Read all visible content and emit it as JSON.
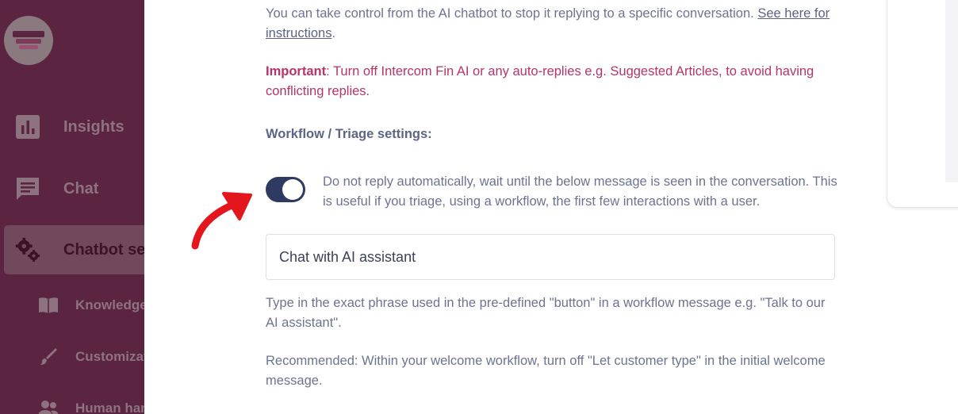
{
  "sidebar": {
    "items": [
      {
        "label": "Insights",
        "icon": "bar-chart-icon"
      },
      {
        "label": "Chat",
        "icon": "chat-icon"
      },
      {
        "label": "Chatbot settings",
        "icon": "gears-icon",
        "active": true
      }
    ],
    "subitems": [
      {
        "label": "Knowledge",
        "icon": "book-icon"
      },
      {
        "label": "Customization",
        "icon": "brush-icon"
      },
      {
        "label": "Human handoff",
        "icon": "users-icon"
      }
    ]
  },
  "main": {
    "intro_text": "You can take control from the AI chatbot to stop it replying to a specific conversation. ",
    "intro_link": "See here for instructions",
    "intro_end": ".",
    "important_label": "Important",
    "important_text": ": Turn off Intercom Fin AI or any auto-replies e.g. Suggested Articles, to avoid having conflicting replies.",
    "workflow_title": "Workflow / Triage settings:",
    "toggle_on": true,
    "toggle_text": "Do not reply automatically, wait until the below message is seen in the conversation. This is useful if you triage, using a workflow, the first few interactions with a user.",
    "phrase_value": "Chat with AI assistant",
    "help_text": "Type in the exact phrase used in the pre-defined \"button\" in a workflow message e.g. \"Talk to our AI assistant\".",
    "recommended_text": "Recommended: Within your welcome workflow, turn off \"Let customer type\" in the initial welcome message."
  },
  "colors": {
    "sidebar_bg": "#5b2440",
    "important": "#b8336a",
    "toggle": "#2f3a63",
    "arrow": "#e3161e"
  }
}
